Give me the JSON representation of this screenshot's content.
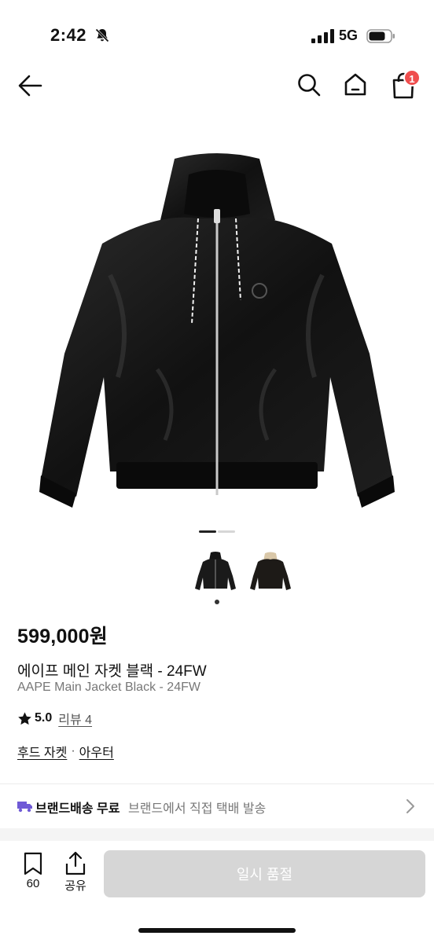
{
  "status_bar": {
    "time": "2:42",
    "network": "5G",
    "icons": [
      "bell-slash-icon",
      "signal-icon",
      "battery-icon"
    ]
  },
  "nav": {
    "icons": [
      "back-arrow-icon",
      "search-icon",
      "home-icon",
      "cart-icon"
    ],
    "cart_badge": "1",
    "accent_color": "#ef4e4e"
  },
  "gallery": {
    "image_count": 2,
    "active_index": 0,
    "thumbnails": [
      "black-jacket-thumbnail",
      "black-jacket-beige-hood-thumbnail"
    ]
  },
  "product": {
    "price": "599,000원",
    "name_ko": "에이프 메인 자켓 블랙 - 24FW",
    "name_en": "AAPE Main Jacket Black - 24FW",
    "rating": "5.0",
    "review_label": "리뷰 4",
    "categories": [
      "후드 자켓",
      "아우터"
    ],
    "category_separator": "·"
  },
  "shipping": {
    "title": "브랜드배송 무료",
    "description": "브랜드에서 직접 택배 발송",
    "icon_color": "#6f5ad6"
  },
  "bottom_bar": {
    "bookmark_count": "60",
    "share_label": "공유",
    "buy_button_label": "일시 품절",
    "buy_button_color": "#d6d6d6"
  }
}
